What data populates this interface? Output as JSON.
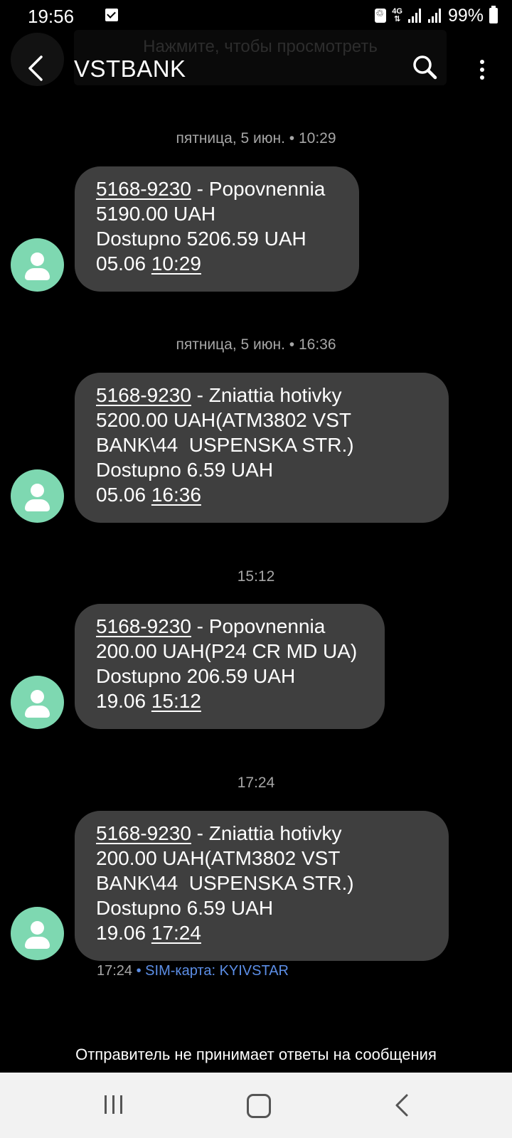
{
  "status_bar": {
    "time": "19:56",
    "network": "4G",
    "battery": "99%",
    "icons": [
      "checkbox-notification-icon",
      "recycle-icon",
      "4g-icon",
      "signal-icon",
      "signal-icon",
      "battery-icon"
    ]
  },
  "overlay_banner": {
    "text": "Нажмите, чтобы просмотреть"
  },
  "header": {
    "title": "VSTBANK",
    "icons": [
      "back-arrow-icon",
      "search-icon",
      "more-vert-icon"
    ]
  },
  "colors": {
    "background": "#000000",
    "bubble": "#3f3f3f",
    "avatar": "#7ed8b1",
    "sim_link": "#5c8ee6",
    "nav_bar": "#f2f2f2"
  },
  "messages": [
    {
      "date_label": "пятница, 5 июн. • 10:29",
      "card": "5168-9230",
      "title_rest": " - Popovnennia",
      "lines": [
        "5190.00 UAH",
        "Dostupno 5206.59 UAH"
      ],
      "date": "05.06",
      "time": "10:29"
    },
    {
      "date_label": "пятница, 5 июн. • 16:36",
      "card": "5168-9230",
      "title_rest": " - Zniattia hotivky",
      "lines": [
        "5200.00 UAH(ATM3802 VST",
        "BANK\\44  USPENSKA STR.)",
        "Dostupno 6.59 UAH"
      ],
      "date": "05.06",
      "time": "16:36"
    },
    {
      "date_label": "15:12",
      "card": "5168-9230",
      "title_rest": " - Popovnennia",
      "lines": [
        "200.00 UAH(P24 CR MD UA)",
        "Dostupno 206.59 UAH"
      ],
      "date": "19.06",
      "time": "15:12"
    },
    {
      "date_label": "17:24",
      "card": "5168-9230",
      "title_rest": " - Zniattia hotivky",
      "lines": [
        "200.00 UAH(ATM3802 VST",
        "BANK\\44  USPENSKA STR.)",
        "Dostupno 6.59 UAH"
      ],
      "date": "19.06",
      "time": "17:24"
    }
  ],
  "last_message_meta": {
    "time": "17:24",
    "sim": "• SIM-карта: KYIVSTAR"
  },
  "footer": {
    "note": "Отправитель не принимает ответы на сообщения"
  },
  "nav_bar": {
    "icons": [
      "recent-apps-icon",
      "home-icon",
      "back-icon"
    ]
  }
}
